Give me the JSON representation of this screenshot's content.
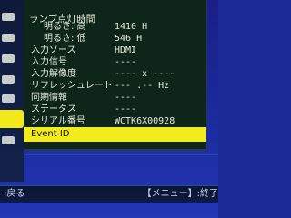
{
  "panel": {
    "header": "ランプ点灯時間",
    "rows": [
      {
        "label": "明るさ: 高",
        "value": "1410 H"
      },
      {
        "label": "明るさ: 低",
        "value": "546 H"
      },
      {
        "label": "入力ソース",
        "value": "HDMI"
      },
      {
        "label": "入力信号",
        "value": "----"
      },
      {
        "label": "入力解像度",
        "value": "---- x ----"
      },
      {
        "label": "リフレッシュレート",
        "value": "--- .-- Hz"
      },
      {
        "label": "同期情報",
        "value": "----"
      },
      {
        "label": "ステータス",
        "value": "----"
      },
      {
        "label": "シリアル番号",
        "value": "WCTK6X00928"
      },
      {
        "label": "Event ID",
        "value": ""
      }
    ]
  },
  "footer": {
    "left": ":戻る",
    "right": "【メニュー】:終了"
  }
}
